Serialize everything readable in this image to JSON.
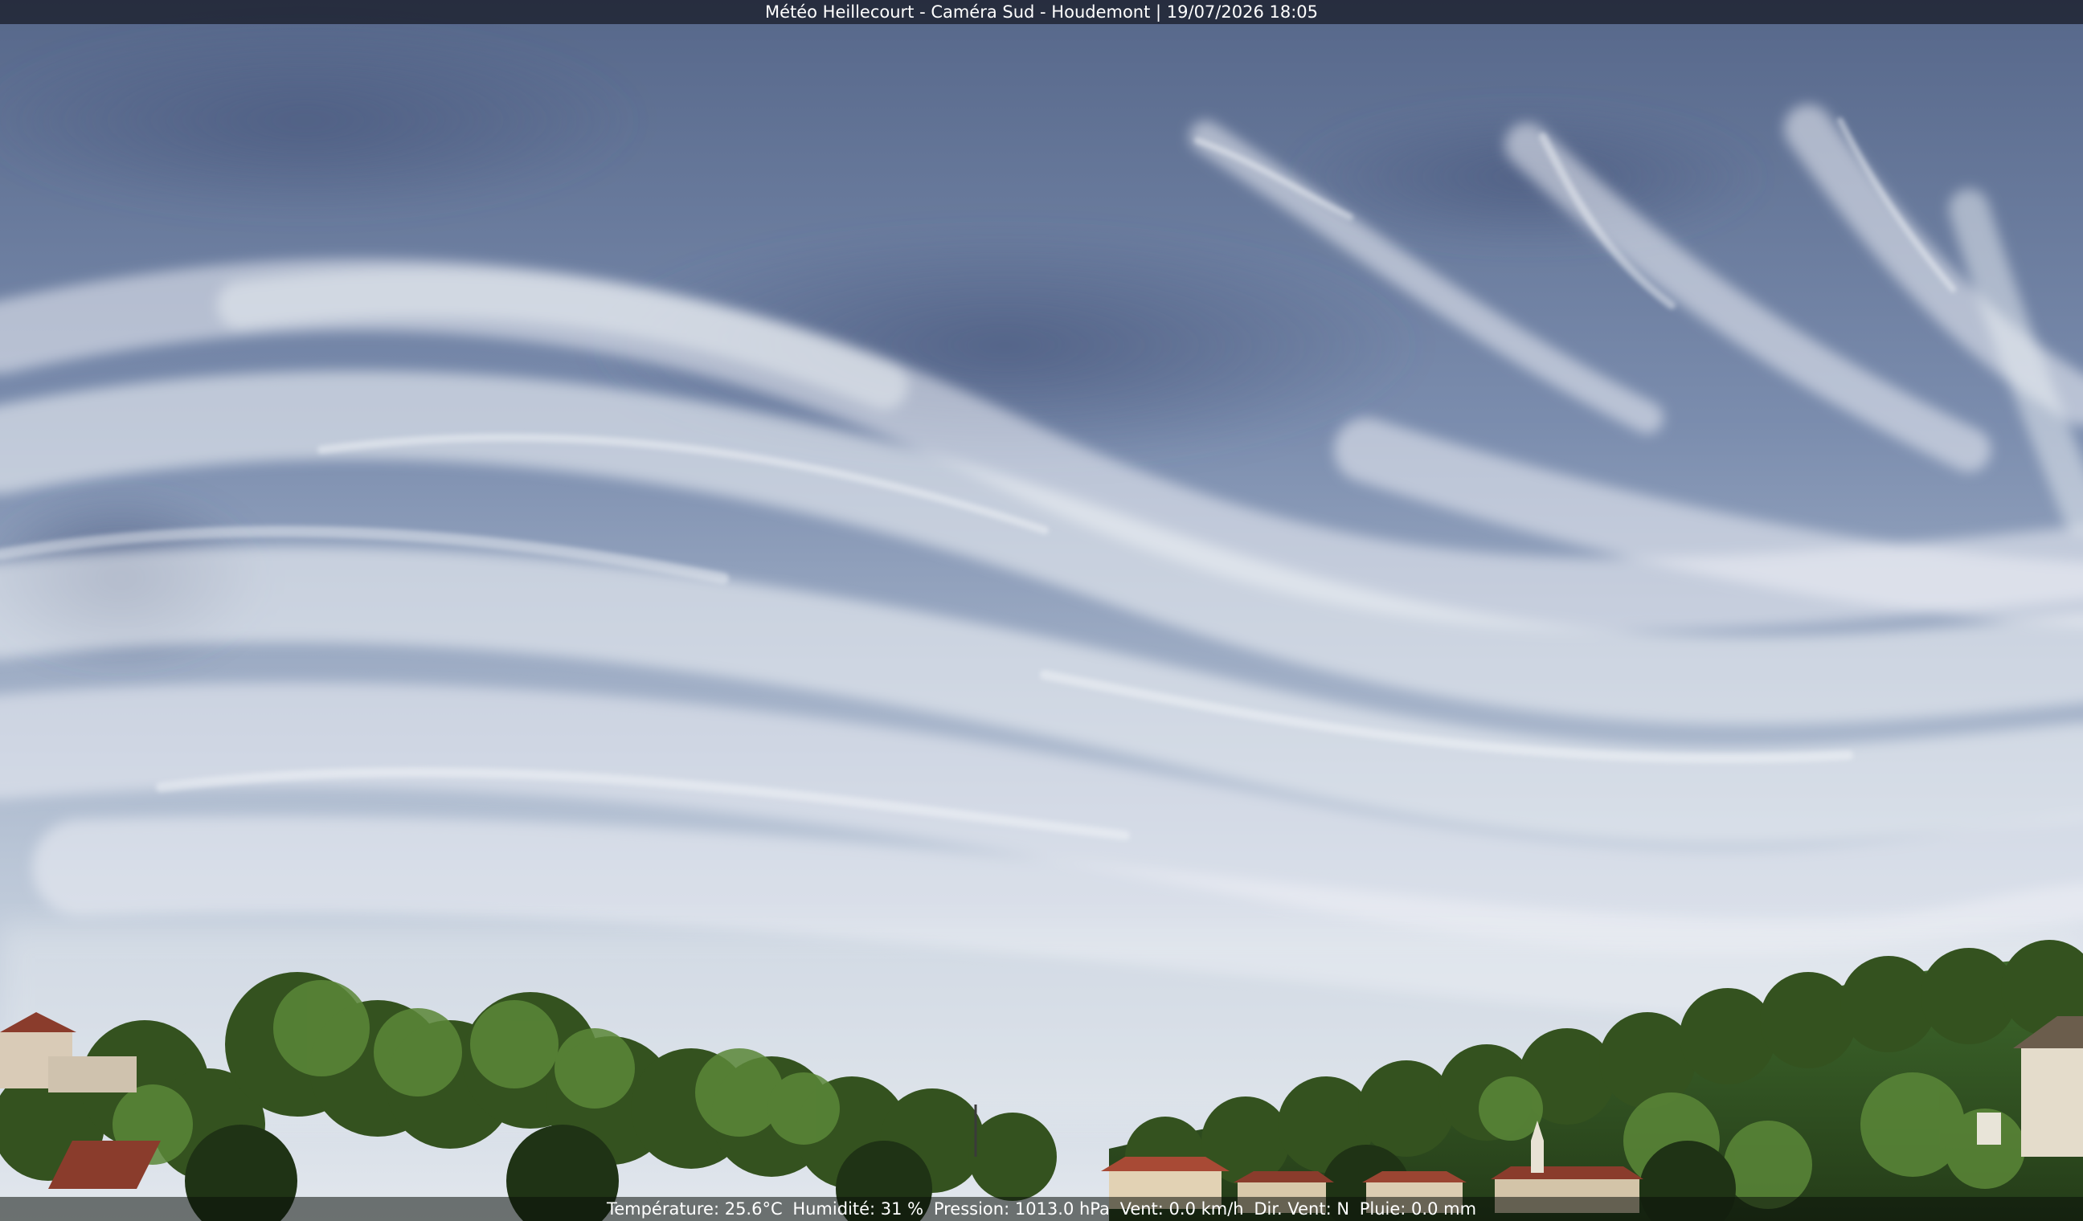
{
  "overlay": {
    "title": "Météo Heillecourt - Caméra Sud - Houdemont | 19/07/2026 18:05",
    "readings": {
      "temperature": "Température: 25.6°C",
      "humidity": "Humidité: 31 %",
      "pressure": "Pression: 1013.0 hPa",
      "wind": "Vent: 0.0 km/h",
      "wind_dir": "Dir. Vent: N",
      "rain": "Pluie: 0.0 mm"
    }
  },
  "colors": {
    "sky_top": "#5d6d8f",
    "sky_mid": "#8a9bb8",
    "sky_low": "#d6dde6",
    "cloud": "#e8ecf1",
    "trees_dark": "#2f4a22",
    "trees_light": "#5f8a3c",
    "roof": "#8a3c2c"
  }
}
